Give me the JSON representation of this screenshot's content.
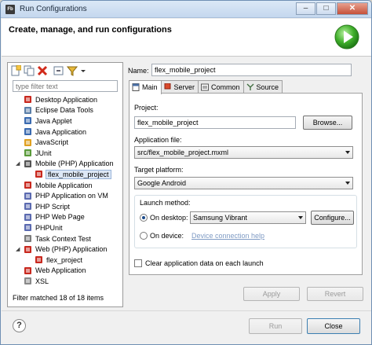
{
  "window": {
    "title": "Run Configurations",
    "app_icon": "Fb",
    "controls": {
      "minimize": "–",
      "maximize": "□",
      "close": "✕"
    }
  },
  "header": {
    "title": "Create, manage, and run configurations",
    "icon": "run-green-icon"
  },
  "left_panel": {
    "toolbar": [
      "new-config-icon",
      "duplicate-icon",
      "delete-icon",
      "collapse-all-icon",
      "filter-icon",
      "dropdown-arrow-icon"
    ],
    "filter_placeholder": "type filter text",
    "items": [
      {
        "label": "Desktop Application",
        "icon": "desktop-app-icon",
        "level": 0
      },
      {
        "label": "Eclipse Data Tools",
        "icon": "data-tools-icon",
        "level": 0
      },
      {
        "label": "Java Applet",
        "icon": "java-applet-icon",
        "level": 0
      },
      {
        "label": "Java Application",
        "icon": "java-app-icon",
        "level": 0
      },
      {
        "label": "JavaScript",
        "icon": "javascript-icon",
        "level": 0
      },
      {
        "label": "JUnit",
        "icon": "junit-icon",
        "level": 0
      },
      {
        "label": "Mobile (PHP) Application",
        "icon": "mobile-php-icon",
        "level": 0,
        "expanded": true
      },
      {
        "label": "flex_mobile_project",
        "icon": "flex-project-icon",
        "level": 1,
        "selected": true
      },
      {
        "label": "Mobile Application",
        "icon": "mobile-app-icon",
        "level": 0
      },
      {
        "label": "PHP Application on VM",
        "icon": "php-vm-icon",
        "level": 0
      },
      {
        "label": "PHP Script",
        "icon": "php-script-icon",
        "level": 0
      },
      {
        "label": "PHP Web Page",
        "icon": "php-web-icon",
        "level": 0
      },
      {
        "label": "PHPUnit",
        "icon": "phpunit-icon",
        "level": 0
      },
      {
        "label": "Task Context Test",
        "icon": "task-context-icon",
        "level": 0
      },
      {
        "label": "Web (PHP) Application",
        "icon": "web-php-icon",
        "level": 0,
        "expanded": true
      },
      {
        "label": "flex_project",
        "icon": "flex-project-icon",
        "level": 1
      },
      {
        "label": "Web Application",
        "icon": "web-app-icon",
        "level": 0
      },
      {
        "label": "XSL",
        "icon": "xsl-icon",
        "level": 0
      }
    ],
    "status": "Filter matched 18 of 18 items"
  },
  "config": {
    "name_label": "Name:",
    "name_value": "flex_mobile_project",
    "tabs": [
      {
        "label": "Main",
        "icon": "main-tab-icon",
        "active": true
      },
      {
        "label": "Server",
        "icon": "server-tab-icon"
      },
      {
        "label": "Common",
        "icon": "common-tab-icon"
      },
      {
        "label": "Source",
        "icon": "source-tab-icon"
      }
    ],
    "project_label": "Project:",
    "project_value": "flex_mobile_project",
    "browse_label": "Browse...",
    "app_file_label": "Application file:",
    "app_file_value": "src/flex_mobile_project.mxml",
    "platform_label": "Target platform:",
    "platform_value": "Google Android",
    "launch_method_label": "Launch method:",
    "on_desktop_label": "On desktop:",
    "desktop_device_value": "Samsung Vibrant",
    "configure_label": "Configure...",
    "on_device_label": "On device:",
    "device_link": "Device connection help",
    "clear_data_label": "Clear application data on each launch",
    "apply_label": "Apply",
    "revert_label": "Revert"
  },
  "footer": {
    "help_label": "?",
    "run_label": "Run",
    "close_label": "Close"
  }
}
